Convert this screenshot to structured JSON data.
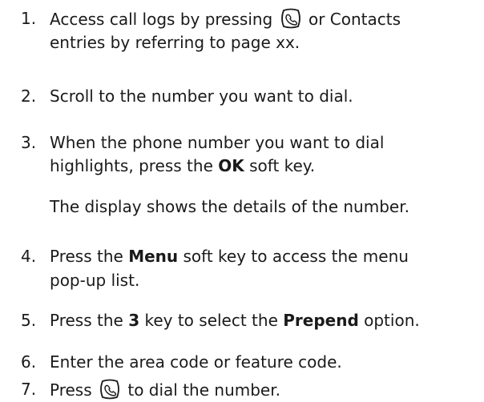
{
  "steps": [
    {
      "num": "1.",
      "line1_pre": "Access call logs by pressing ",
      "line1_icon": "send-key-icon",
      "line1_post": " or Contacts",
      "line2": "entries by referring to page xx."
    },
    {
      "num": "2.",
      "text": "Scroll to the number you want to dial."
    },
    {
      "num": "3.",
      "line1": "When the phone number you want to dial",
      "line2_pre": "highlights, press the ",
      "line2_bold": "OK",
      "line2_post": " soft key.",
      "note": "The display shows the details of the number."
    },
    {
      "num": "4.",
      "line1_pre": "Press the ",
      "line1_bold": "Menu",
      "line1_post": " soft key to access the menu",
      "line2": "pop-up list."
    },
    {
      "num": "5.",
      "pre": "Press the ",
      "bold1": "3",
      "mid": " key to select the ",
      "bold2": "Prepend",
      "post": " option."
    },
    {
      "num": "6.",
      "text": "Enter the area code or feature code."
    },
    {
      "num": "7.",
      "pre": "Press ",
      "icon": "send-key-icon",
      "post": " to dial the number."
    }
  ]
}
